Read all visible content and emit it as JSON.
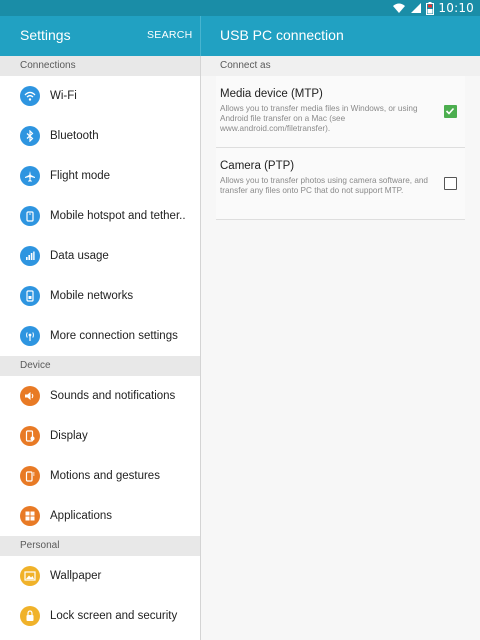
{
  "status_bar": {
    "time": "10:10",
    "icons": [
      "wifi-icon",
      "signal-icon",
      "battery-icon"
    ]
  },
  "left_pane": {
    "title": "Settings",
    "search_label": "SEARCH",
    "sections": [
      {
        "header": "Connections",
        "items": [
          {
            "label": "Wi-Fi",
            "icon": "wifi-icon",
            "color": "#2e95e0"
          },
          {
            "label": "Bluetooth",
            "icon": "bluetooth-icon",
            "color": "#2e95e0"
          },
          {
            "label": "Flight mode",
            "icon": "airplane-icon",
            "color": "#2e95e0"
          },
          {
            "label": "Mobile hotspot and tether..",
            "icon": "hotspot-icon",
            "color": "#2e95e0"
          },
          {
            "label": "Data usage",
            "icon": "data-usage-icon",
            "color": "#2e95e0"
          },
          {
            "label": "Mobile networks",
            "icon": "mobile-network-icon",
            "color": "#2e95e0"
          },
          {
            "label": "More connection settings",
            "icon": "more-connections-icon",
            "color": "#2e95e0"
          }
        ]
      },
      {
        "header": "Device",
        "items": [
          {
            "label": "Sounds and notifications",
            "icon": "sound-icon",
            "color": "#e87a25"
          },
          {
            "label": "Display",
            "icon": "display-icon",
            "color": "#e87a25"
          },
          {
            "label": "Motions and gestures",
            "icon": "motion-icon",
            "color": "#e87a25"
          },
          {
            "label": "Applications",
            "icon": "apps-icon",
            "color": "#e87a25"
          }
        ]
      },
      {
        "header": "Personal",
        "items": [
          {
            "label": "Wallpaper",
            "icon": "wallpaper-icon",
            "color": "#f0b22a"
          },
          {
            "label": "Lock screen and security",
            "icon": "lock-icon",
            "color": "#f0b22a"
          }
        ]
      }
    ]
  },
  "right_pane": {
    "title": "USB PC connection",
    "section_header": "Connect as",
    "options": [
      {
        "title": "Media device (MTP)",
        "description": "Allows you to transfer media files in Windows, or using Android file transfer on a Mac (see www.android.com/filetransfer).",
        "checked": true
      },
      {
        "title": "Camera (PTP)",
        "description": "Allows you to transfer photos using camera software, and transfer any files onto PC that do not support MTP.",
        "checked": false
      }
    ]
  },
  "colors": {
    "status_bar": "#1a8da7",
    "app_bar": "#21a1c2",
    "checked": "#4cae4f"
  }
}
